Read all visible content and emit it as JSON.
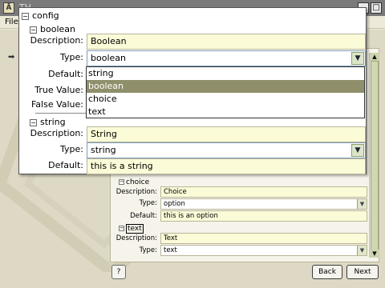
{
  "app": {
    "title": "TH...",
    "menu_file": "File",
    "window_buttons": [
      "_",
      "□",
      "x"
    ]
  },
  "background": {
    "choice": {
      "header": "choice",
      "description_label": "Description:",
      "description_value": "Choice",
      "type_label": "Type:",
      "type_value": "option",
      "default_label": "Default:",
      "default_value": "this is an option"
    },
    "text": {
      "header": "text",
      "description_label": "Description:",
      "description_value": "Text",
      "type_label": "Type:",
      "type_value": "text"
    }
  },
  "buttons": {
    "help": "?",
    "back": "Back",
    "next": "Next"
  },
  "popup": {
    "root_label": "config",
    "boolean": {
      "header": "boolean",
      "description_label": "Description:",
      "description_value": "Boolean",
      "type_label": "Type:",
      "type_value": "boolean",
      "default_label": "Default:",
      "true_label": "True Value:",
      "false_label": "False Value:"
    },
    "string": {
      "header": "string",
      "description_label": "Description:",
      "description_value": "String",
      "type_label": "Type:",
      "type_value": "string",
      "default_label": "Default:",
      "default_value": "this is a string"
    },
    "dropdown_options": [
      "string",
      "boolean",
      "choice",
      "text"
    ],
    "dropdown_selected": "boolean"
  },
  "colors": {
    "field_bg": "#fbfbd8",
    "selected_option_bg": "#8f8f6c",
    "titlebar_bg": "#7a7a7a"
  }
}
